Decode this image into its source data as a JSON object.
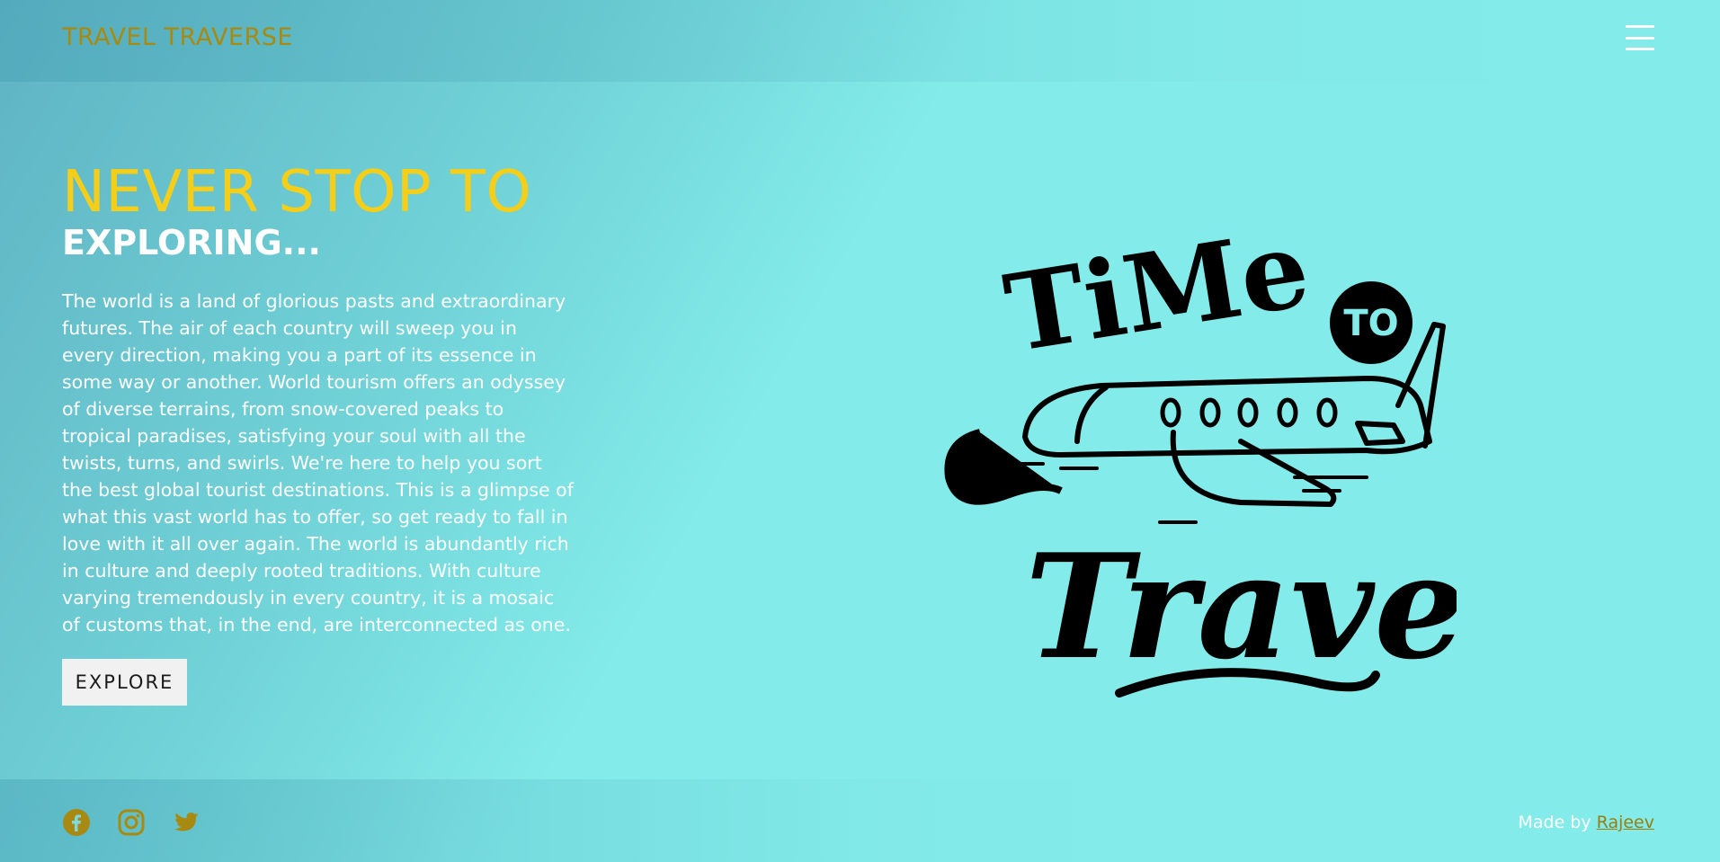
{
  "header": {
    "logo": "TRAVEL TRAVERSE",
    "menu_icon": "hamburger-menu-icon"
  },
  "hero": {
    "headline_line1": "NEVER STOP TO",
    "headline_line2": "EXPLORING...",
    "body": "The world is a land of glorious pasts and extraordinary futures. The air of each country will sweep you in every direction, making you a part of its essence in some way or another. World tourism offers an odyssey of diverse terrains, from snow-covered peaks to tropical paradises, satisfying your soul with all the twists, turns, and swirls. We're here to help you sort the best global tourist destinations. This is a glimpse of what this vast world has to offer, so get ready to fall in love with it all over again. The world is abundantly rich in culture and deeply rooted traditions. With culture varying tremendously in every country, it is a mosaic of customs that, in the end, are interconnected as one.",
    "cta_label": "EXPLORE",
    "illustration": {
      "word1": "TiMe",
      "word2": "TO",
      "word3": "Travel"
    }
  },
  "footer": {
    "social_icons": [
      "facebook-icon",
      "instagram-icon",
      "twitter-icon"
    ],
    "credit_prefix": "Made by",
    "credit_author": "Rajeev"
  },
  "colors": {
    "accent_gold": "#f5ce1a",
    "logo_gold": "#a88a12",
    "background": "#83ebe9"
  }
}
